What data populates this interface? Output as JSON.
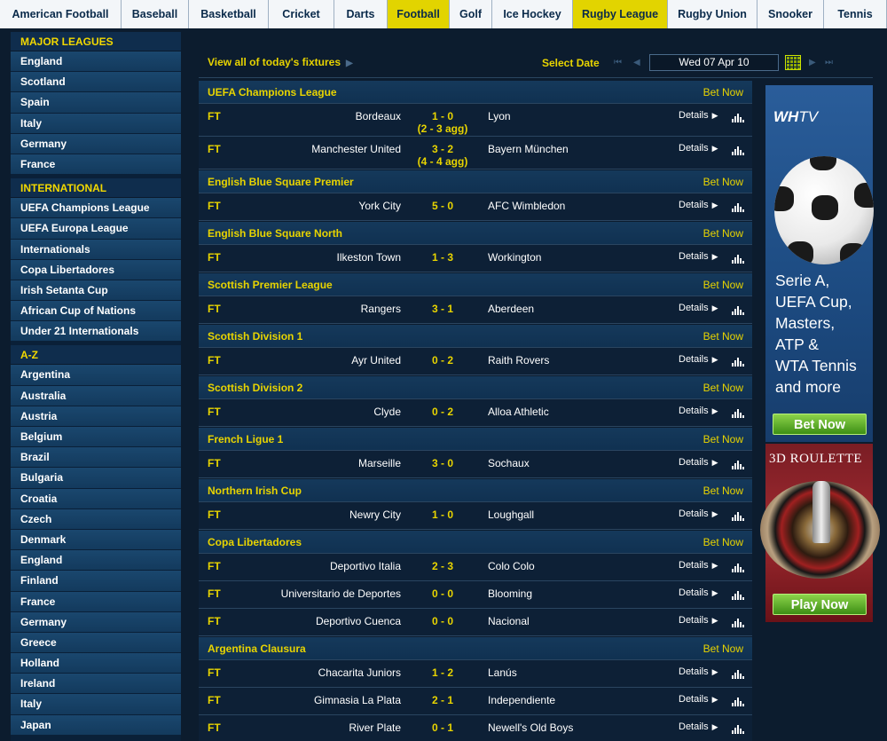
{
  "topnav": {
    "tabs": [
      {
        "label": "American Football",
        "active": false,
        "w": 137
      },
      {
        "label": "Baseball",
        "active": false,
        "w": 76
      },
      {
        "label": "Basketball",
        "active": false,
        "w": 90
      },
      {
        "label": "Cricket",
        "active": false,
        "w": 74
      },
      {
        "label": "Darts",
        "active": false,
        "w": 60
      },
      {
        "label": "Football",
        "active": true,
        "w": 70
      },
      {
        "label": "Golf",
        "active": false,
        "w": 48
      },
      {
        "label": "Ice Hockey",
        "active": false,
        "w": 91
      },
      {
        "label": "Rugby League",
        "active": true,
        "w": 107
      },
      {
        "label": "Rugby Union",
        "active": false,
        "w": 101
      },
      {
        "label": "Snooker",
        "active": false,
        "w": 75
      },
      {
        "label": "Tennis",
        "active": false,
        "w": 71
      }
    ]
  },
  "sidebar": {
    "groups": [
      {
        "heading": "MAJOR LEAGUES",
        "items": [
          "England",
          "Scotland",
          "Spain",
          "Italy",
          "Germany",
          "France"
        ]
      },
      {
        "heading": "INTERNATIONAL",
        "items": [
          "UEFA Champions League",
          "UEFA Europa League",
          "Internationals",
          "Copa Libertadores",
          "Irish Setanta Cup",
          "African Cup of Nations",
          "Under 21 Internationals"
        ]
      },
      {
        "heading": "A-Z",
        "items": [
          "Argentina",
          "Australia",
          "Austria",
          "Belgium",
          "Brazil",
          "Bulgaria",
          "Croatia",
          "Czech",
          "Denmark",
          "England",
          "Finland",
          "France",
          "Germany",
          "Greece",
          "Holland",
          "Ireland",
          "Italy",
          "Japan"
        ]
      }
    ]
  },
  "toolbar": {
    "fixtures_link": "View all of today's fixtures",
    "select_date_label": "Select Date",
    "date_value": "Wed 07 Apr 10"
  },
  "fixtures": [
    {
      "competition": "UEFA Champions League",
      "bet_label": "Bet Now",
      "matches": [
        {
          "status": "FT",
          "home": "Bordeaux",
          "score": "1 - 0",
          "agg": "(2 - 3 agg)",
          "away": "Lyon",
          "details": "Details"
        },
        {
          "status": "FT",
          "home": "Manchester United",
          "score": "3 - 2",
          "agg": "(4 - 4 agg)",
          "away": "Bayern München",
          "details": "Details"
        }
      ]
    },
    {
      "competition": "English Blue Square Premier",
      "bet_label": "Bet Now",
      "matches": [
        {
          "status": "FT",
          "home": "York City",
          "score": "5 - 0",
          "away": "AFC Wimbledon",
          "details": "Details"
        }
      ]
    },
    {
      "competition": "English Blue Square North",
      "bet_label": "Bet Now",
      "matches": [
        {
          "status": "FT",
          "home": "Ilkeston Town",
          "score": "1 - 3",
          "away": "Workington",
          "details": "Details"
        }
      ]
    },
    {
      "competition": "Scottish Premier League",
      "bet_label": "Bet Now",
      "matches": [
        {
          "status": "FT",
          "home": "Rangers",
          "score": "3 - 1",
          "away": "Aberdeen",
          "details": "Details"
        }
      ]
    },
    {
      "competition": "Scottish Division 1",
      "bet_label": "Bet Now",
      "matches": [
        {
          "status": "FT",
          "home": "Ayr United",
          "score": "0 - 2",
          "away": "Raith Rovers",
          "details": "Details"
        }
      ]
    },
    {
      "competition": "Scottish Division 2",
      "bet_label": "Bet Now",
      "matches": [
        {
          "status": "FT",
          "home": "Clyde",
          "score": "0 - 2",
          "away": "Alloa Athletic",
          "details": "Details"
        }
      ]
    },
    {
      "competition": "French Ligue 1",
      "bet_label": "Bet Now",
      "matches": [
        {
          "status": "FT",
          "home": "Marseille",
          "score": "3 - 0",
          "away": "Sochaux",
          "details": "Details"
        }
      ]
    },
    {
      "competition": "Northern Irish Cup",
      "bet_label": "Bet Now",
      "matches": [
        {
          "status": "FT",
          "home": "Newry City",
          "score": "1 - 0",
          "away": "Loughgall",
          "details": "Details"
        }
      ]
    },
    {
      "competition": "Copa Libertadores",
      "bet_label": "Bet Now",
      "matches": [
        {
          "status": "FT",
          "home": "Deportivo Italia",
          "score": "2 - 3",
          "away": "Colo Colo",
          "details": "Details"
        },
        {
          "status": "FT",
          "home": "Universitario de Deportes",
          "score": "0 - 0",
          "away": "Blooming",
          "details": "Details"
        },
        {
          "status": "FT",
          "home": "Deportivo Cuenca",
          "score": "0 - 0",
          "away": "Nacional",
          "details": "Details"
        }
      ]
    },
    {
      "competition": "Argentina Clausura",
      "bet_label": "Bet Now",
      "matches": [
        {
          "status": "FT",
          "home": "Chacarita Juniors",
          "score": "1 - 2",
          "away": "Lanús",
          "details": "Details"
        },
        {
          "status": "FT",
          "home": "Gimnasia La Plata",
          "score": "2 - 1",
          "away": "Independiente",
          "details": "Details"
        },
        {
          "status": "FT",
          "home": "River Plate",
          "score": "0 - 1",
          "away": "Newell's Old Boys",
          "details": "Details"
        }
      ]
    }
  ],
  "ads": {
    "whtv": {
      "logo_prefix": "WH",
      "logo_suffix": "TV",
      "lines": [
        "Serie A,",
        "UEFA Cup,",
        "Masters,",
        "ATP &",
        "WTA Tennis",
        "and more"
      ],
      "button": "Bet Now"
    },
    "roulette": {
      "title": "3D ROULETTE",
      "button": "Play Now"
    }
  },
  "icons": {
    "stats": "bar-chart-icon",
    "calendar": "calendar-icon",
    "chevron": "chevron-right-icon"
  },
  "colors": {
    "accent_yellow": "#e8d400",
    "active_tab": "#e2d400",
    "page_bg": "#0c1c2e",
    "sidebar_item": "#1a476e",
    "bet_button": "#5db325",
    "roulette_bg": "#8a1f25"
  }
}
